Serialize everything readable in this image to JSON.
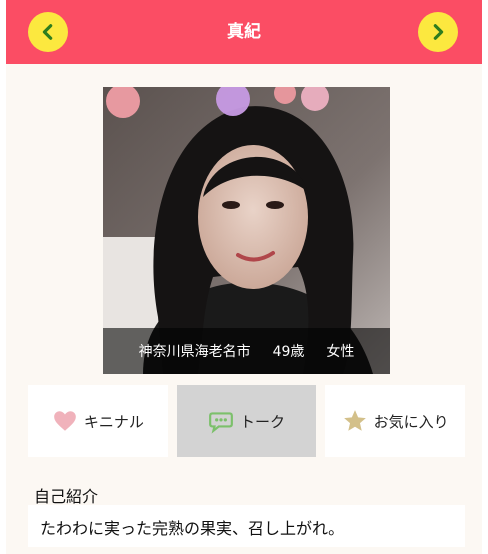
{
  "header": {
    "title": "真紀",
    "prev_icon": "chevron-left-icon",
    "next_icon": "chevron-right-icon",
    "background_color": "#fb4d64",
    "button_color": "#fce83f"
  },
  "profile": {
    "location": "神奈川県海老名市",
    "age": "49歳",
    "gender": "女性"
  },
  "actions": [
    {
      "label": "キニナル",
      "icon": "heart-icon",
      "active": false
    },
    {
      "label": "トーク",
      "icon": "chat-bubble-icon",
      "active": true
    },
    {
      "label": "お気に入り",
      "icon": "star-icon",
      "active": false
    }
  ],
  "intro": {
    "heading": "自己紹介",
    "text": "たわわに実った完熟の果実、召し上がれ。"
  }
}
